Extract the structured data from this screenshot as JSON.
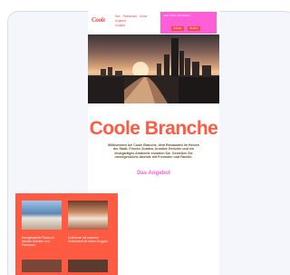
{
  "site": {
    "logo": "Coole",
    "nav_items": [
      "Das",
      "Restaurant",
      "Unser",
      "Angebot"
    ],
    "nav_sub": "Kontakt",
    "cta_text": "Jetzt Tisch reservieren",
    "cta_buttons": [
      "Anrufen",
      "Buchen"
    ]
  },
  "hero": {
    "alt": "Skyline"
  },
  "page": {
    "title": "Coole Branche",
    "intro": "Willkommen bei Coole Branche, dem Restaurant im Herzen der Stadt. Frische Zutaten, kreative Gerichte und ein einzigartiges Ambiente erwarten Sie. Genießen Sie unvergessliche Abende mit Freunden und Familie.",
    "section_title": "Das Angebot"
  },
  "offers": [
    {
      "text": "Hausgemachte Pasta mit frischen Kräutern und Parmesan"
    },
    {
      "text": "Kochkurse mit unserem Küchenchef für kleine Gruppen"
    }
  ]
}
